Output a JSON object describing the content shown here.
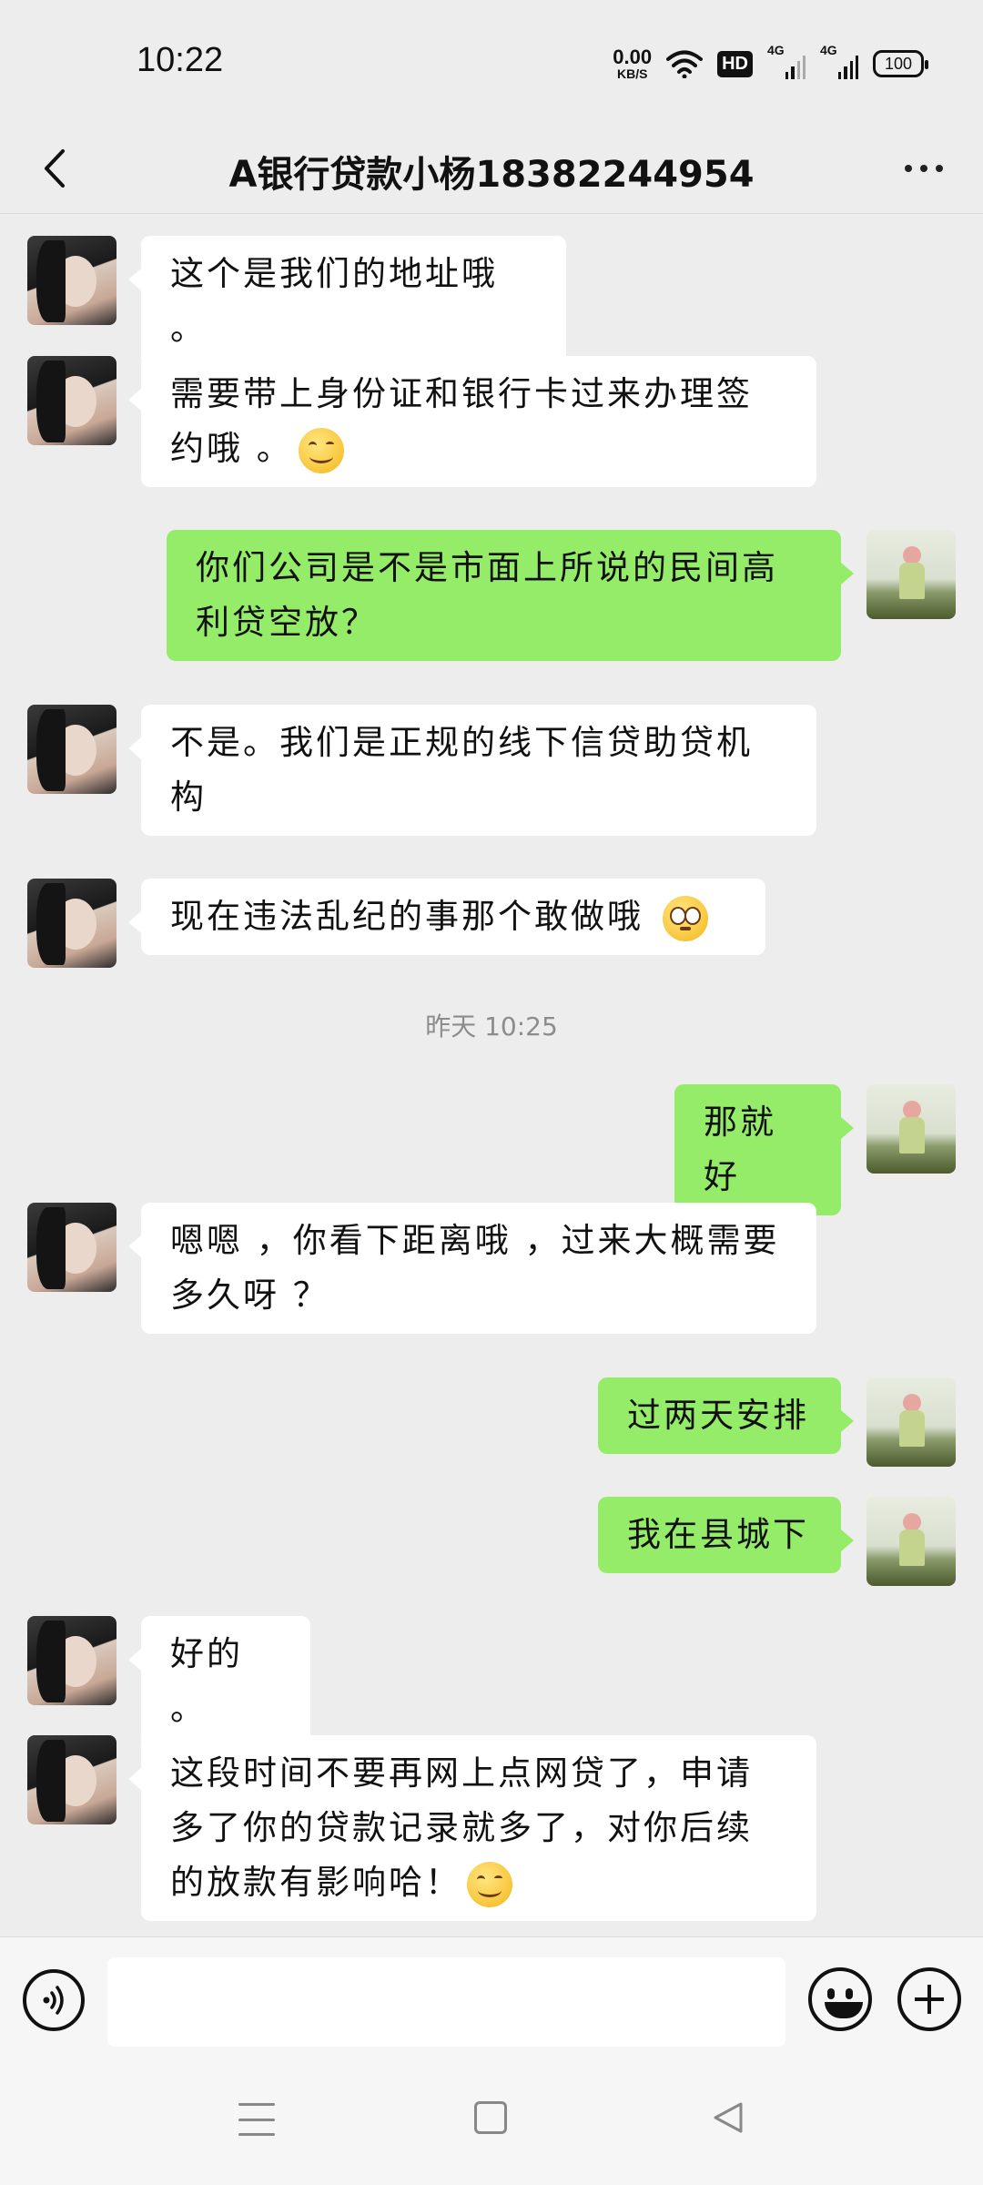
{
  "status_bar": {
    "time": "10:22",
    "net_speed_value": "0.00",
    "net_speed_unit": "KB/S",
    "hd_label": "HD",
    "signal1_label": "4G",
    "signal2_label": "4G",
    "battery": "100"
  },
  "header": {
    "title": "A银行贷款小杨18382244954",
    "back_icon": "chevron-left-icon",
    "more_icon": "more-dots-icon"
  },
  "messages": [
    {
      "side": "in",
      "text": "这个是我们的地址哦 。",
      "emoji": ""
    },
    {
      "side": "in",
      "text": "需要带上身份证和银行卡过来办理签约哦 。",
      "emoji": "smile"
    },
    {
      "side": "out",
      "text": "你们公司是不是市面上所说的民间高利贷空放？",
      "emoji": ""
    },
    {
      "side": "in",
      "text": " 不是。我们是正规的线下信贷助贷机构",
      "emoji": ""
    },
    {
      "side": "in",
      "text": "现在违法乱纪的事那个敢做哦 ",
      "emoji": "rolling-eyes"
    },
    {
      "side": "out",
      "text": "那就好",
      "emoji": ""
    },
    {
      "side": "in",
      "text": " 嗯嗯 ，你看下距离哦 ，过来大概需要多久呀 ？",
      "emoji": ""
    },
    {
      "side": "out",
      "text": "过两天安排",
      "emoji": ""
    },
    {
      "side": "out",
      "text": "我在县城下",
      "emoji": ""
    },
    {
      "side": "in",
      "text": "好的 。",
      "emoji": ""
    },
    {
      "side": "in",
      "text": "这段时间不要再网上点网贷了，申请多了你的贷款记录就多了，对你后续的放款有影响哈！",
      "emoji": "smile"
    }
  ],
  "timestamp": "昨天 10:25",
  "input_bar": {
    "voice_icon": "voice-icon",
    "input_value": "",
    "emoji_icon": "emoji-icon",
    "plus_icon": "plus-icon"
  },
  "nav_bar": {
    "icons": [
      "menu-icon",
      "home-square-icon",
      "back-triangle-icon"
    ]
  },
  "colors": {
    "background": "#ededed",
    "incoming_bubble": "#ffffff",
    "outgoing_bubble": "#95ec69"
  }
}
